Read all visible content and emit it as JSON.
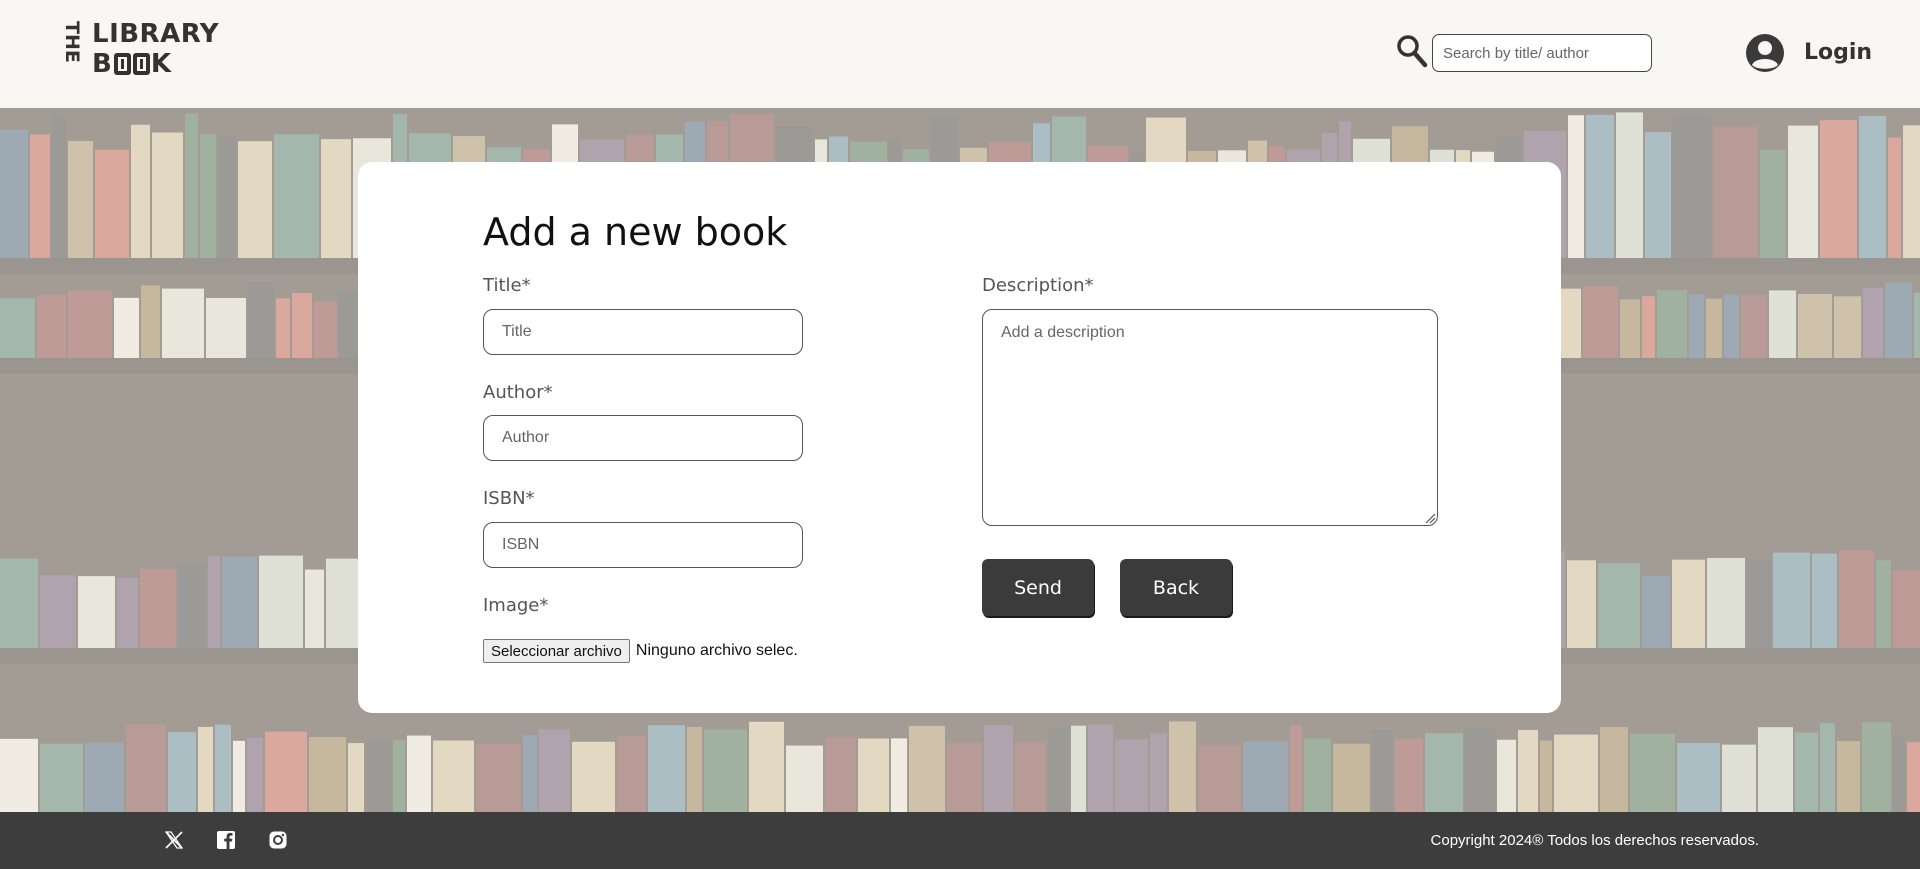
{
  "header": {
    "logo": {
      "the": "THE",
      "line1": "LIBRARY",
      "line2_prefix": "B",
      "line2_suffix": "K"
    },
    "search": {
      "placeholder": "Search by title/ author",
      "value": ""
    },
    "login_label": "Login"
  },
  "form": {
    "title": "Add a new book",
    "title_field": {
      "label": "Title*",
      "placeholder": "Title"
    },
    "author_field": {
      "label": "Author*",
      "placeholder": "Author"
    },
    "isbn_field": {
      "label": "ISBN*",
      "placeholder": "ISBN"
    },
    "image_field": {
      "label": "Image*",
      "button": "Seleccionar archivo",
      "status": "Ninguno archivo selec."
    },
    "description_field": {
      "label": "Description*",
      "placeholder": "Add a description"
    },
    "send_label": "Send",
    "back_label": "Back"
  },
  "footer": {
    "social": [
      "x-icon",
      "facebook-icon",
      "instagram-icon"
    ],
    "copyright": "Copyright 2024® Todos los derechos reservados."
  },
  "colors": {
    "header_bg": "#f8f7f3",
    "button_dark": "#3b3b3b",
    "footer_bg": "#3d3d3d",
    "text_dark": "#333333"
  }
}
